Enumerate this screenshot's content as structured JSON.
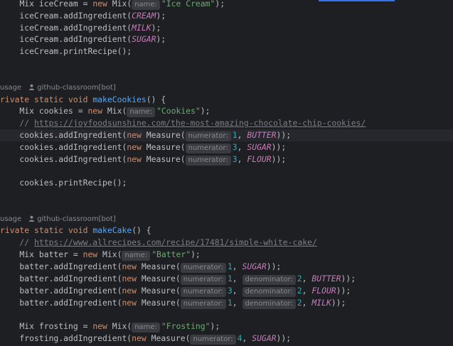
{
  "editor": {
    "lines": {
      "l1": {
        "indent": "    ",
        "t1": "Mix iceCream = ",
        "kw": "new",
        "t2": " Mix(",
        "hint": "name:",
        "str": "\"Ice Cream\"",
        "end": ");"
      },
      "l2": {
        "t1": "    iceCream.addIngredient(",
        "cst": "CREAM",
        "end": ");"
      },
      "l3": {
        "t1": "    iceCream.addIngredient(",
        "cst": "MILK",
        "end": ");"
      },
      "l4": {
        "t1": "    iceCream.addIngredient(",
        "cst": "SUGAR",
        "end": ");"
      },
      "l5": {
        "t1": "    iceCream.printRecipe();"
      },
      "meta1": {
        "usage": "usage",
        "author": "github-classroom[bot]"
      },
      "l6": {
        "kw": "rivate static void ",
        "fn": "makeCookies",
        "end": "() {"
      },
      "l7": {
        "t1": "    Mix cookies = ",
        "kw": "new",
        "t2": " Mix(",
        "hint": "name:",
        "str": "\"Cookies\"",
        "end": ");"
      },
      "l8": {
        "cmt": "    // ",
        "link": "https://joyfoodsunshine.com/the-most-amazing-chocolate-chip-cookies/"
      },
      "l9": {
        "t1": "    cookies.addIngredient(",
        "kw": "new",
        "t2": " Measure(",
        "hint": "numerator:",
        "num": "1",
        "sep": ", ",
        "cst": "BUTTER",
        "end": "));"
      },
      "l10": {
        "t1": "    cookies.addIngredient(",
        "kw": "new",
        "t2": " Measure(",
        "hint": "numerator:",
        "num": "3",
        "sep": ", ",
        "cst": "SUGAR",
        "end": "));"
      },
      "l11": {
        "t1": "    cookies.addIngredient(",
        "kw": "new",
        "t2": " Measure(",
        "hint": "numerator:",
        "num": "3",
        "sep": ", ",
        "cst": "FLOUR",
        "end": "));"
      },
      "l12": {
        "t1": "    cookies.printRecipe();"
      },
      "meta2": {
        "usage": "usage",
        "author": "github-classroom[bot]"
      },
      "l13": {
        "kw": "rivate static void ",
        "fn": "makeCake",
        "end": "() {"
      },
      "l14": {
        "cmt": "    // ",
        "link": "https://www.allrecipes.com/recipe/17481/simple-white-cake/"
      },
      "l15": {
        "t1": "    Mix batter = ",
        "kw": "new",
        "t2": " Mix(",
        "hint": "name:",
        "str": "\"Batter\"",
        "end": ");"
      },
      "l16": {
        "t1": "    batter.addIngredient(",
        "kw": "new",
        "t2": " Measure(",
        "hint": "numerator:",
        "num": "1",
        "sep": ", ",
        "cst": "SUGAR",
        "end": "));"
      },
      "l17": {
        "t1": "    batter.addIngredient(",
        "kw": "new",
        "t2": " Measure(",
        "hint": "numerator:",
        "num": "1",
        "sep": ", ",
        "hint2": "denominator:",
        "num2": "2",
        "sep2": ", ",
        "cst": "BUTTER",
        "end": "));"
      },
      "l18": {
        "t1": "    batter.addIngredient(",
        "kw": "new",
        "t2": " Measure(",
        "hint": "numerator:",
        "num": "3",
        "sep": ", ",
        "hint2": "denominator:",
        "num2": "2",
        "sep2": ", ",
        "cst": "FLOUR",
        "end": "));"
      },
      "l19": {
        "t1": "    batter.addIngredient(",
        "kw": "new",
        "t2": " Measure(",
        "hint": "numerator:",
        "num": "1",
        "sep": ", ",
        "hint2": "denominator:",
        "num2": "2",
        "sep2": ", ",
        "cst": "MILK",
        "end": "));"
      },
      "l20": {
        "t1": "    Mix frosting = ",
        "kw": "new",
        "t2": " Mix(",
        "hint": "name:",
        "str": "\"Frosting\"",
        "end": ");"
      },
      "l21": {
        "t1": "    frosting.addIngredient(",
        "kw": "new",
        "t2": " Measure(",
        "hint": "numerator:",
        "num": "4",
        "sep": ", ",
        "cst": "SUGAR",
        "end": "));"
      }
    }
  },
  "colors": {
    "accent": "#3574f0",
    "background": "#1e1f22"
  },
  "icons": {
    "author": "person-icon"
  }
}
